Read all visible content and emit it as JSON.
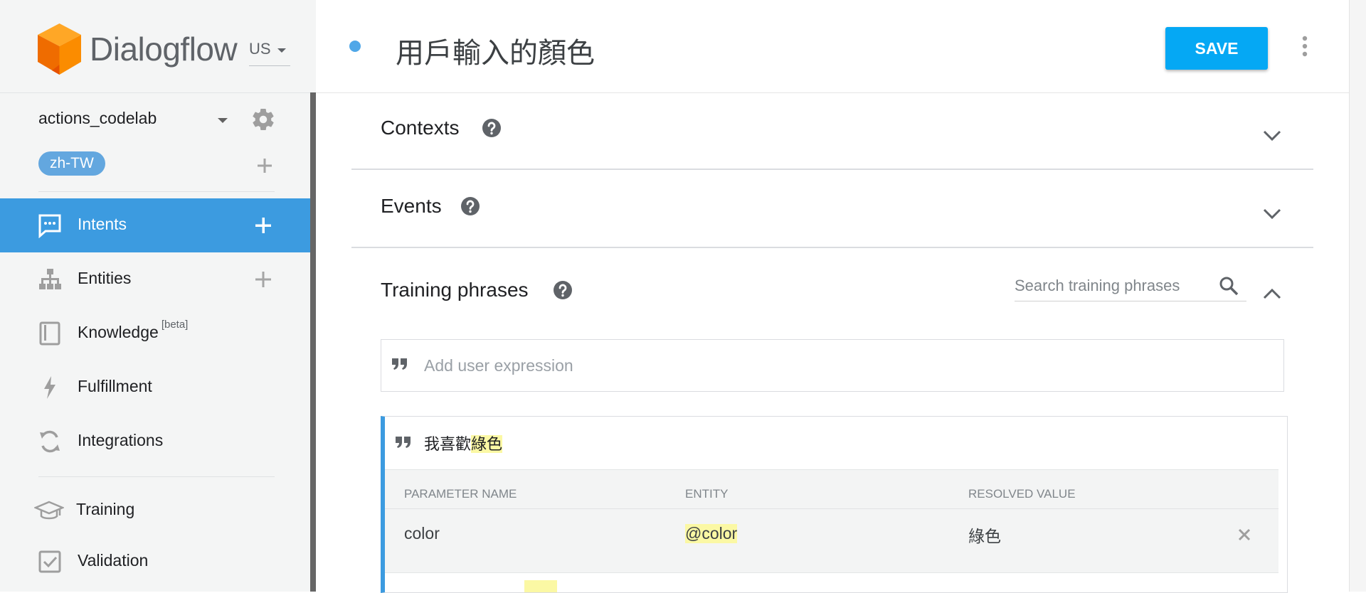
{
  "sidebar": {
    "logo_text": "Dialogflow",
    "region": "US",
    "agent_name": "actions_codelab",
    "language": "zh-TW",
    "nav": {
      "intents": "Intents",
      "entities": "Entities",
      "knowledge": "Knowledge",
      "knowledge_badge": "[beta]",
      "fulfillment": "Fulfillment",
      "integrations": "Integrations",
      "training": "Training",
      "validation": "Validation"
    },
    "active_item": "Intents"
  },
  "header": {
    "intent_title": "用戶輸入的顏色",
    "save_label": "SAVE"
  },
  "sections": {
    "contexts": "Contexts",
    "events": "Events",
    "training_phrases": "Training phrases"
  },
  "search": {
    "placeholder": "Search training phrases",
    "value": ""
  },
  "add_expression": {
    "placeholder": "Add user expression",
    "value": ""
  },
  "phrase": {
    "prefix": "我喜歡",
    "annotated": "綠色"
  },
  "parameter_table": {
    "headers": [
      "PARAMETER NAME",
      "ENTITY",
      "RESOLVED VALUE"
    ],
    "rows": [
      {
        "name": "color",
        "entity": "@color",
        "resolved": "綠色"
      }
    ]
  },
  "colors": {
    "accent": "#3c9be0",
    "save_button": "#05a8f4",
    "highlight": "#fbf8a4",
    "logo_orange": "#ff8a00"
  },
  "icons": [
    "dialogflow-logo",
    "gear-icon",
    "add-icon",
    "intents-icon",
    "entities-icon",
    "knowledge-icon",
    "fulfillment-icon",
    "integrations-icon",
    "training-icon",
    "validation-icon",
    "help-icon",
    "chevron-down-icon",
    "chevron-up-icon",
    "search-icon",
    "quote-icon",
    "close-icon",
    "more-vert-icon"
  ]
}
